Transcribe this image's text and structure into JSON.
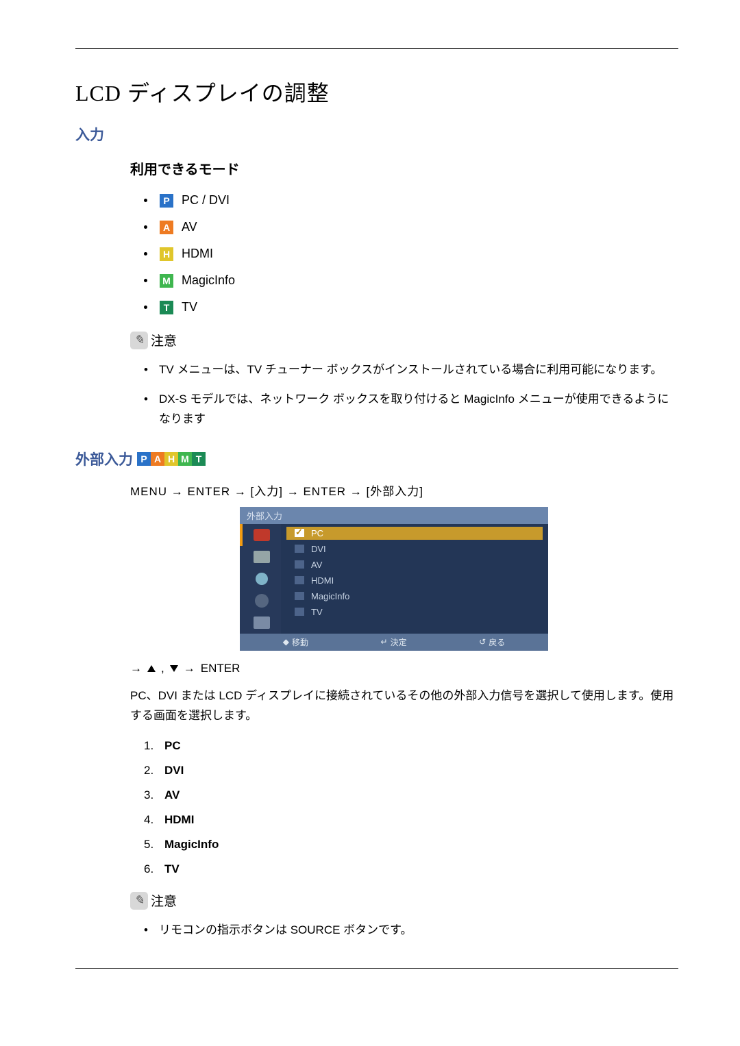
{
  "title": "LCD ディスプレイの調整",
  "section_input": "入力",
  "available_modes_heading": "利用できるモード",
  "modes": [
    {
      "letter": "P",
      "cls": "badge-p",
      "label": "PC / DVI"
    },
    {
      "letter": "A",
      "cls": "badge-a",
      "label": "AV"
    },
    {
      "letter": "H",
      "cls": "badge-h",
      "label": "HDMI"
    },
    {
      "letter": "M",
      "cls": "badge-m",
      "label": "MagicInfo"
    },
    {
      "letter": "T",
      "cls": "badge-t",
      "label": "TV"
    }
  ],
  "note_label": "注意",
  "notes1": [
    "TV メニューは、TV チューナー ボックスがインストールされている場合に利用可能になります。",
    "DX-S モデルでは、ネットワーク ボックスを取り付けると MagicInfo メニューが使用できるようになります"
  ],
  "ext_input_heading": "外部入力",
  "ext_badges": [
    "P",
    "A",
    "H",
    "M",
    "T"
  ],
  "nav_path": "MENU → ENTER → [入力] → ENTER → [外部入力]",
  "osd": {
    "title": "外部入力",
    "items": [
      "PC",
      "DVI",
      "AV",
      "HDMI",
      "MagicInfo",
      "TV"
    ],
    "selected": "PC",
    "foot_move": "移動",
    "foot_enter": "決定",
    "foot_back": "戻る"
  },
  "nav2_prefix_arrow": "→",
  "nav2_enter": "ENTER",
  "desc": "PC、DVI または LCD ディスプレイに接続されているその他の外部入力信号を選択して使用します。使用する画面を選択します。",
  "num_list": [
    "PC",
    "DVI",
    "AV",
    "HDMI",
    "MagicInfo",
    "TV"
  ],
  "notes2": [
    "リモコンの指示ボタンは SOURCE ボタンです。"
  ]
}
